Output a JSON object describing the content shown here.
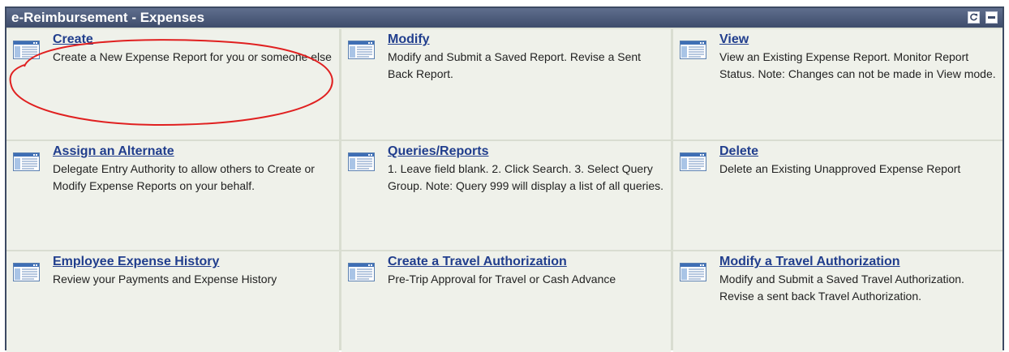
{
  "pagelet": {
    "title": "e-Reimbursement - Expenses"
  },
  "items": [
    {
      "title": "Create",
      "desc": "Create a New Expense Report for you or someone else"
    },
    {
      "title": "Modify",
      "desc": "Modify and Submit a Saved Report. Revise a Sent Back Report."
    },
    {
      "title": "View",
      "desc": "View an Existing Expense Report. Monitor Report Status. Note: Changes can not be made in View mode."
    },
    {
      "title": "Assign an Alternate",
      "desc": "Delegate Entry Authority to allow others to Create or Modify Expense Reports on your behalf."
    },
    {
      "title": "Queries/Reports",
      "desc": "1. Leave field blank. 2. Click Search. 3. Select Query Group. Note: Query 999 will display a list of all queries."
    },
    {
      "title": "Delete",
      "desc": "Delete an Existing Unapproved Expense Report"
    },
    {
      "title": "Employee Expense History",
      "desc": "Review your Payments and Expense History"
    },
    {
      "title": "Create a Travel Authorization",
      "desc": "Pre-Trip Approval for Travel or Cash Advance"
    },
    {
      "title": "Modify a Travel Authorization",
      "desc": "Modify and Submit a Saved Travel Authorization. Revise a sent back Travel Authorization."
    }
  ],
  "icons": {
    "item_icon": "window-page-icon",
    "refresh": "refresh-icon",
    "minimize": "minimize-icon"
  },
  "colors": {
    "titlebar": "#3e4c6b",
    "link": "#213e8d",
    "cell_bg": "#eff1ea",
    "annotation": "#e02020"
  }
}
